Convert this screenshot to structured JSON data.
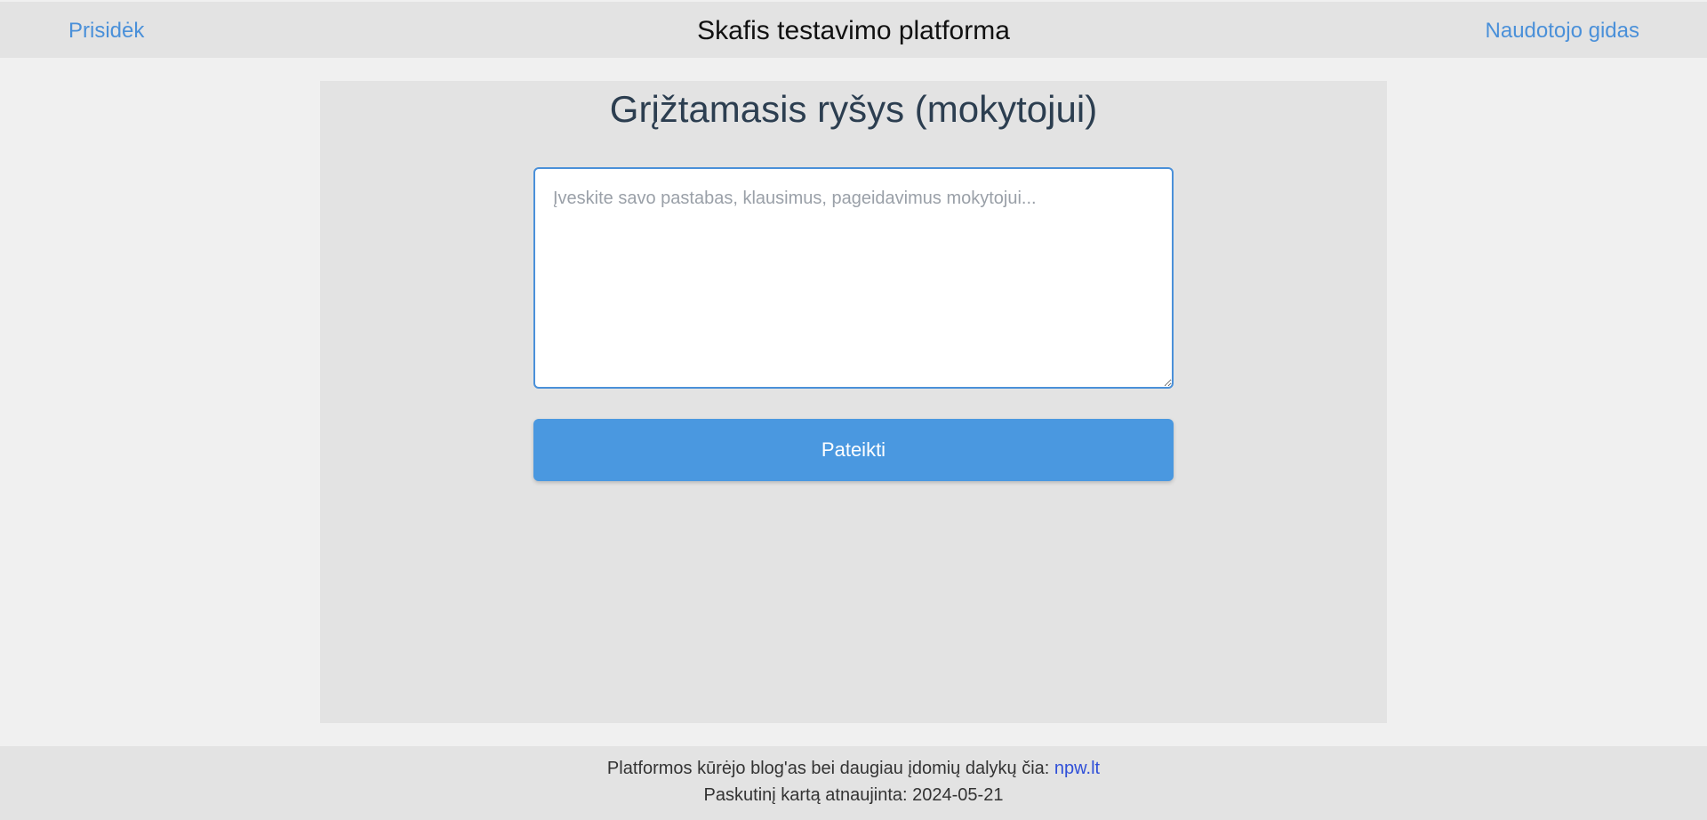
{
  "header": {
    "left_link": "Prisidėk",
    "title": "Skafis testavimo platforma",
    "right_link": "Naudotojo gidas"
  },
  "main": {
    "title": "Grįžtamasis ryšys (mokytojui)",
    "feedback": {
      "value": "",
      "placeholder": "Įveskite savo pastabas, klausimus, pageidavimus mokytojui..."
    },
    "submit_label": "Pateikti"
  },
  "footer": {
    "blog_text": "Platformos kūrėjo blog'as bei daugiau įdomių dalykų čia:",
    "blog_link": "npw.lt",
    "updated_label": "Paskutinį kartą atnaujinta:",
    "updated_date": "2024-05-21"
  },
  "colors": {
    "accent": "#4a90d9",
    "button": "#4a98e0",
    "footer_link": "#2f4fd8",
    "header_bg": "#e3e3e3",
    "page_bg": "#f0f0f0"
  }
}
